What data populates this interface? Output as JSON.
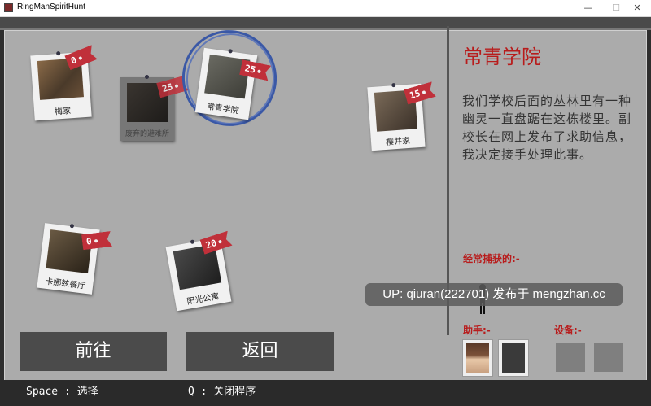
{
  "window": {
    "title": "RingManSpiritHunt",
    "min": "—",
    "max": "☐",
    "close": "✕"
  },
  "locations": [
    {
      "name": "梅家",
      "tag": "0",
      "state": "normal"
    },
    {
      "name": "废弃的避难所",
      "tag": "25",
      "state": "disabled"
    },
    {
      "name": "常青学院",
      "tag": "25",
      "state": "selected"
    },
    {
      "name": "樱井家",
      "tag": "15",
      "state": "normal"
    },
    {
      "name": "卡娜兹餐厅",
      "tag": "0",
      "state": "normal"
    },
    {
      "name": "阳光公寓",
      "tag": "20",
      "state": "normal"
    }
  ],
  "panel": {
    "title": "常青学院",
    "description": "我们学校后面的丛林里有一种幽灵一直盘踞在这栋楼里。副校长在网上发布了求助信息，我决定接手处理此事。",
    "captured_label": "经常捕获的:-",
    "assistant_label": "助手:-",
    "equipment_label": "设备:-"
  },
  "buttons": {
    "go": "前往",
    "back": "返回"
  },
  "watermark": "UP: qiuran(222701) 发布于 mengzhan.cc",
  "footer": {
    "space_hint": "Space : 选择",
    "q_hint": "Q : 关闭程序"
  },
  "colors": {
    "accent": "#b81c1c",
    "tag": "#c0303a",
    "ring": "#3a58a6"
  }
}
